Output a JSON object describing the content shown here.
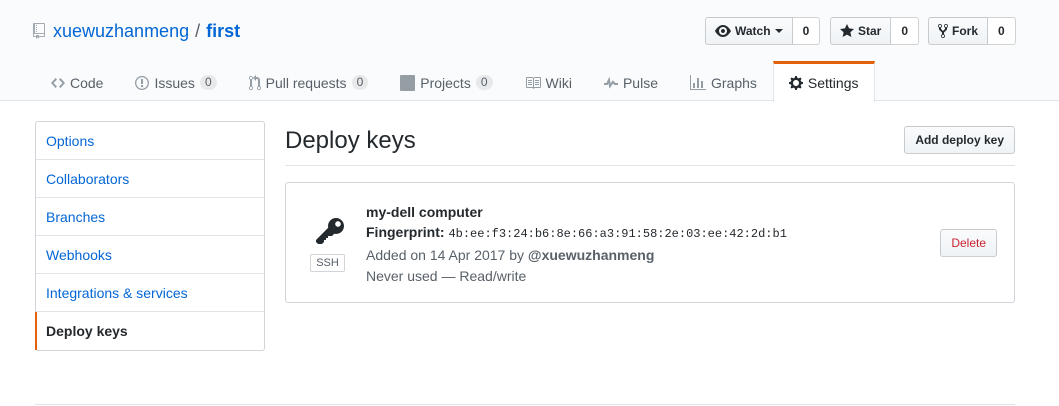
{
  "repo": {
    "owner": "xuewuzhanmeng",
    "separator": "/",
    "name": "first"
  },
  "actions": {
    "watch": {
      "label": "Watch",
      "count": "0"
    },
    "star": {
      "label": "Star",
      "count": "0"
    },
    "fork": {
      "label": "Fork",
      "count": "0"
    }
  },
  "tabs": [
    {
      "label": "Code"
    },
    {
      "label": "Issues",
      "counter": "0"
    },
    {
      "label": "Pull requests",
      "counter": "0"
    },
    {
      "label": "Projects",
      "counter": "0"
    },
    {
      "label": "Wiki"
    },
    {
      "label": "Pulse"
    },
    {
      "label": "Graphs"
    },
    {
      "label": "Settings"
    }
  ],
  "sidebar": {
    "items": [
      {
        "label": "Options"
      },
      {
        "label": "Collaborators"
      },
      {
        "label": "Branches"
      },
      {
        "label": "Webhooks"
      },
      {
        "label": "Integrations & services"
      },
      {
        "label": "Deploy keys"
      }
    ],
    "selected": "Deploy keys"
  },
  "main": {
    "heading": "Deploy keys",
    "add_button": "Add deploy key",
    "key": {
      "title": "my-dell computer",
      "fingerprint_label": "Fingerprint:",
      "fingerprint": "4b:ee:f3:24:b6:8e:66:a3:91:58:2e:03:ee:42:2d:b1",
      "added_prefix": "Added on 14 Apr 2017 by",
      "added_by": "@xuewuzhanmeng",
      "usage": "Never used — Read/write",
      "type_badge": "SSH",
      "delete_label": "Delete"
    }
  },
  "colors": {
    "link": "#0366d6",
    "accent": "#e36209",
    "danger": "#cb2431"
  }
}
